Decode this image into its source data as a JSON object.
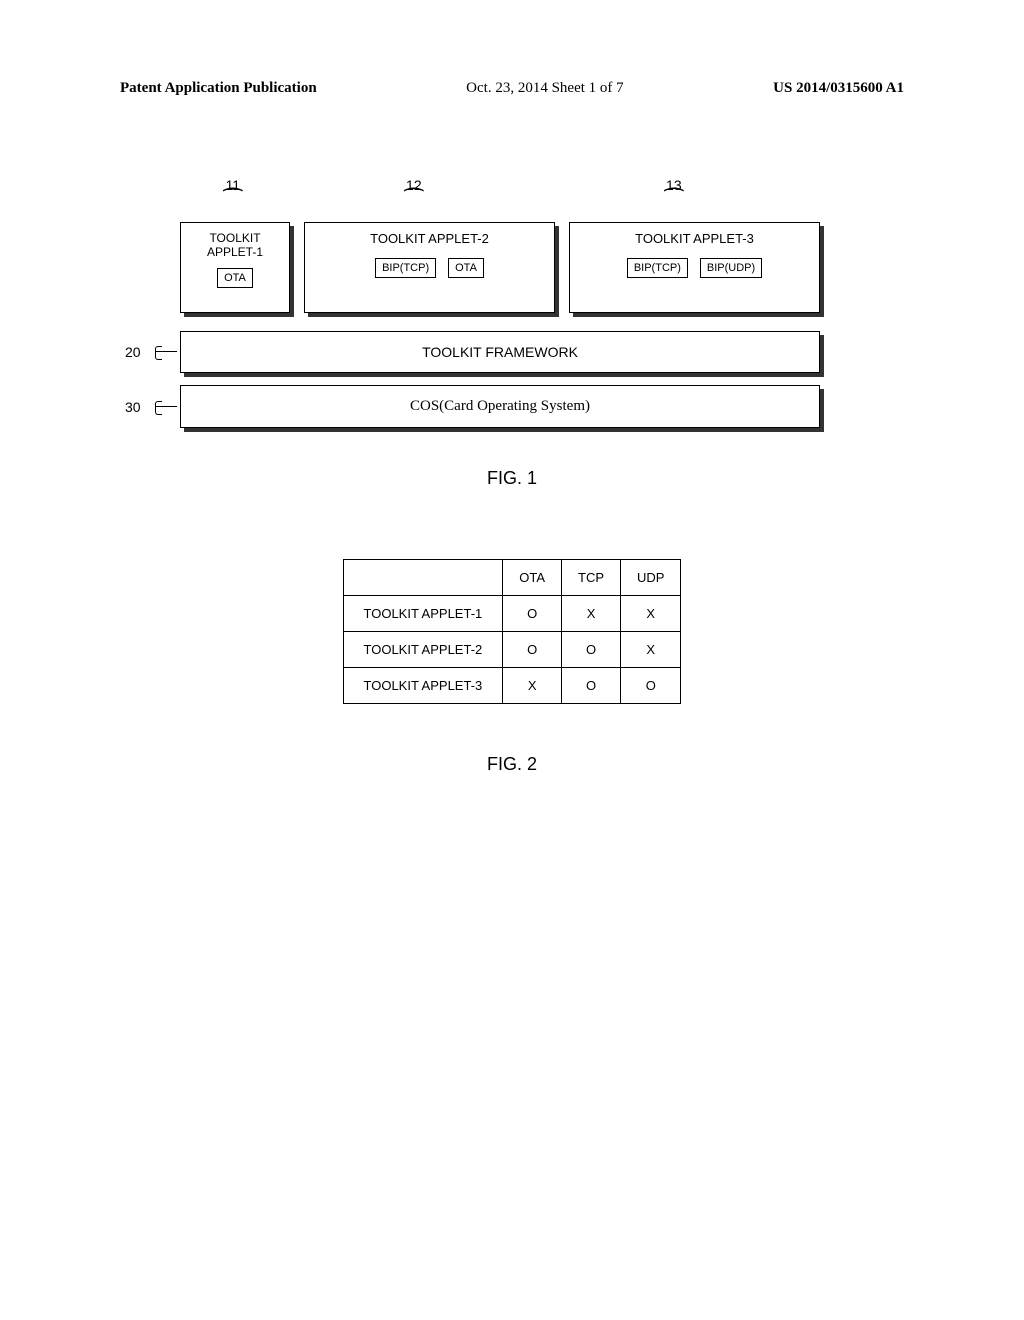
{
  "header": {
    "left": "Patent Application Publication",
    "mid": "Oct. 23, 2014  Sheet 1 of 7",
    "right": "US 2014/0315600 A1"
  },
  "fig1": {
    "refs": {
      "r1": "11",
      "r2": "12",
      "r3": "13",
      "r20": "20",
      "r30": "30"
    },
    "applet1": {
      "title_l1": "TOOLKIT",
      "title_l2": "APPLET-1",
      "tag": "OTA"
    },
    "applet2": {
      "title": "TOOLKIT APPLET-2",
      "tag1": "BIP(TCP)",
      "tag2": "OTA"
    },
    "applet3": {
      "title": "TOOLKIT APPLET-3",
      "tag1": "BIP(TCP)",
      "tag2": "BIP(UDP)"
    },
    "framework": "TOOLKIT FRAMEWORK",
    "cos": "COS(Card Operating System)",
    "caption": "FIG. 1"
  },
  "fig2": {
    "caption": "FIG. 2"
  },
  "chart_data": {
    "type": "table",
    "title": "FIG. 2",
    "columns": [
      "",
      "OTA",
      "TCP",
      "UDP"
    ],
    "rows": [
      {
        "name": "TOOLKIT APPLET-1",
        "values": [
          "O",
          "X",
          "X"
        ]
      },
      {
        "name": "TOOLKIT APPLET-2",
        "values": [
          "O",
          "O",
          "X"
        ]
      },
      {
        "name": "TOOLKIT APPLET-3",
        "values": [
          "X",
          "O",
          "O"
        ]
      }
    ]
  }
}
